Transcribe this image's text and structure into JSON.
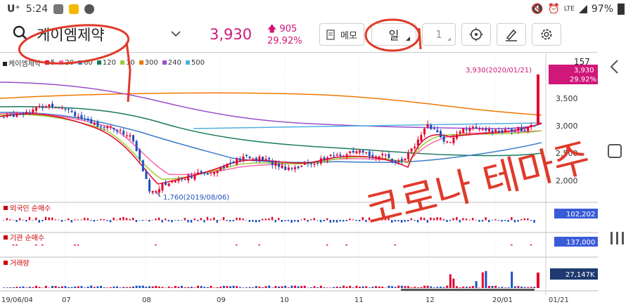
{
  "status_bar": {
    "carrier": "U⁺",
    "time": "5:24",
    "network": "LTE",
    "battery": "97%"
  },
  "toolbar": {
    "stock_name": "케이엠제약",
    "price": "3,930",
    "change_amount": "905",
    "change_percent": "29.92%",
    "memo_label": "메모",
    "period_label": "일",
    "count_value": "1"
  },
  "legend": {
    "stock": "케이엠제약",
    "ma": [
      {
        "label": "5",
        "color": "#e4002b"
      },
      {
        "label": "20",
        "color": "#ff66aa"
      },
      {
        "label": "60",
        "color": "#3a7dc9"
      },
      {
        "label": "120",
        "color": "#1a7a5a"
      },
      {
        "label": "10",
        "color": "#9acd32"
      },
      {
        "label": "300",
        "color": "#f07800"
      },
      {
        "label": "240",
        "color": "#9b4dca"
      },
      {
        "label": "500",
        "color": "#4fb0e0"
      }
    ]
  },
  "price_axis": {
    "top_value": "157",
    "current_price": "3,930",
    "current_change": "29.92%",
    "ticks": [
      "3,500",
      "3,000",
      "2,500",
      "2,000"
    ]
  },
  "annotations": {
    "high_label": "3,930(2020/01/21)",
    "low_label": "1,760(2019/08/06)"
  },
  "panels": {
    "foreign": {
      "title": "외국인 순매수",
      "value": "102,202"
    },
    "institution": {
      "title": "기관 순매수",
      "value": "137,000"
    },
    "volume": {
      "title": "거래량",
      "value": "27,147K"
    }
  },
  "x_axis": [
    "19/06/04",
    "07",
    "08",
    "09",
    "10",
    "11",
    "12",
    "20/01",
    "01/21"
  ],
  "handwriting": "코로나 테마주",
  "colors": {
    "up": "#e4002b",
    "down": "#1f4fbf",
    "accent": "#d0177a",
    "annotation": "#e03a2a"
  },
  "chart_data": {
    "type": "candlestick",
    "period": "daily",
    "x_range": [
      "2019-06-04",
      "2020-01-21"
    ],
    "ylim": [
      1700,
      4000
    ],
    "y_ticks": [
      2000,
      2500,
      3000,
      3500
    ],
    "close_series": [
      [
        "2019-06-04",
        3150
      ],
      [
        "2019-06-14",
        3260
      ],
      [
        "2019-06-24",
        3380
      ],
      [
        "2019-07-01",
        3320
      ],
      [
        "2019-07-10",
        3050
      ],
      [
        "2019-07-19",
        2980
      ],
      [
        "2019-07-29",
        2800
      ],
      [
        "2019-08-02",
        2300
      ],
      [
        "2019-08-06",
        1780
      ],
      [
        "2019-08-14",
        1960
      ],
      [
        "2019-08-23",
        2080
      ],
      [
        "2019-08-30",
        2120
      ],
      [
        "2019-09-06",
        2250
      ],
      [
        "2019-09-16",
        2420
      ],
      [
        "2019-09-24",
        2380
      ],
      [
        "2019-10-04",
        2220
      ],
      [
        "2019-10-14",
        2300
      ],
      [
        "2019-10-24",
        2450
      ],
      [
        "2019-11-04",
        2500
      ],
      [
        "2019-11-14",
        2440
      ],
      [
        "2019-11-22",
        2330
      ],
      [
        "2019-11-28",
        2600
      ],
      [
        "2019-12-03",
        3050
      ],
      [
        "2019-12-12",
        2680
      ],
      [
        "2019-12-20",
        2950
      ],
      [
        "2019-12-30",
        2890
      ],
      [
        "2020-01-08",
        2920
      ],
      [
        "2020-01-15",
        2940
      ],
      [
        "2020-01-20",
        3025
      ],
      [
        "2020-01-21",
        3930
      ]
    ]
  }
}
